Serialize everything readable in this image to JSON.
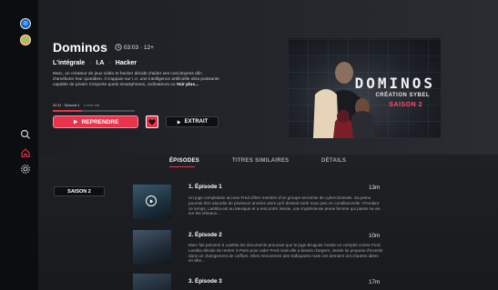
{
  "show": {
    "title": "Dominos",
    "meta": "03:03 · 12+",
    "tags": [
      "L'intégrale",
      "I.A",
      "Hacker"
    ],
    "description": "Marc, un créateur de jeux vidéo et hacker décide d'aider ses concitoyens afin d'améliorer leur quotidien. Il s'appuie sur I.A. une intelligence artificielle ultra puissante capable de pirater n'importe quels smartphones, ordinateurs ou",
    "description_more": "Voir plus...",
    "progress_label": "32:31 · Épisode 1",
    "progress_remaining": "4 mins left",
    "progress_fraction": 0.35
  },
  "poster": {
    "title": "DOMINOS",
    "subtitle": "CRÉATION SYBEL",
    "season": "SAISON 2"
  },
  "actions": {
    "resume_label": "REPRENDRE",
    "extract_label": "EXTRAIT"
  },
  "tabs": [
    {
      "label": "ÉPISODES",
      "active": true
    },
    {
      "label": "TITRES SIMILAIRES",
      "active": false
    },
    {
      "label": "DÉTAILS",
      "active": false
    }
  ],
  "season_selector": "SAISON 2",
  "episodes": [
    {
      "title": "1. Épisode 1",
      "duration": "13m",
      "description": "Un juge complotiste accuse Fred d'être membre d'un groupe terroriste de cybercriminels. Sa peine pourrait être alourdie de plusieurs années alors qu'il dessait sortir sous peu en conditionnelle ! Pendant ce temps, Laetitia est au Mexique et a rencontré Jessie, une mystérieuse jeune femme qui passe sa vie sur les réseaux..."
    },
    {
      "title": "2. Épisode 2",
      "duration": "10m",
      "description": "Marc fait parvenir à Laetitia les documents prouvant que le juge Bruguier monte un complot contre Fred. Laetitia décide de rentrer à Paris pour aider Fred mais elle a besoin d'argent. Jessie lui propose d'investir dans un changement de coiffure. Elles rencontrent des trafiquants mais ces derniers ont d'autres idées en tête..."
    },
    {
      "title": "3. Épisode 3",
      "duration": "17m",
      "description": ""
    }
  ],
  "colors": {
    "accent": "#e8334a",
    "background": "#141619",
    "rail": "#0c0d0f"
  },
  "icons": {
    "meta": "clock-icon",
    "resume": "play-icon",
    "favorite": "heart-icon",
    "extract": "play-icon",
    "rail": [
      "search-icon",
      "home-icon",
      "gear-icon"
    ]
  }
}
